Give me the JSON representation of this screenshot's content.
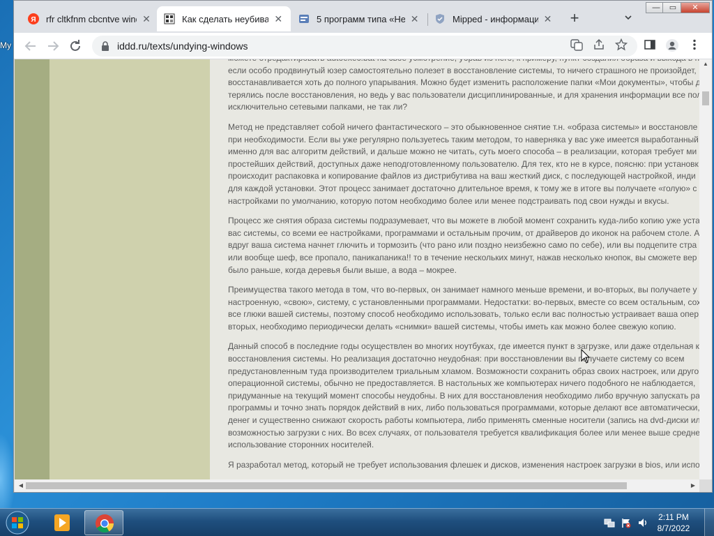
{
  "desktop": {
    "label": "Му"
  },
  "tabs": [
    {
      "label": "rfr cltkfnm cbcntve wind",
      "icon": "yandex-icon",
      "active": false
    },
    {
      "label": "Как сделать неубиваем",
      "icon": "site-favicon-icon",
      "active": true
    },
    {
      "label": "5 программ типа «Неу",
      "icon": "article-favicon-icon",
      "active": false
    },
    {
      "label": "Mipped - информацио",
      "icon": "shield-favicon-icon",
      "active": false
    }
  ],
  "toolbar": {
    "url": "iddd.ru/texts/undying-windows",
    "back_icon": "back-arrow-icon",
    "forward_icon": "forward-arrow-icon",
    "reload_icon": "reload-icon"
  },
  "article": {
    "paragraphs": [
      [
        "можете отредактировать autoexec.bat на свое усмотрение, убрав из него, к примеру, пункт создания образа и выхода в п",
        "если особо продвинутый юзер самостоятельно полезет в восстановление системы, то ничего страшного не произойдет,",
        "восстанавливается хоть до полного упарывания. Можно будет изменить расположение папки «Мои документы», чтобы д",
        "терялись после восстановления, но ведь у вас пользователи дисциплинированные, и для хранения информации все пол",
        "исключительно сетевыми папками, не так ли?"
      ],
      [
        "Метод не представляет собой ничего фантастического – это обыкновенное снятие т.н. «образа системы» и восстановле",
        "при необходимости. Если вы уже регулярно пользуетесь таким методом, то наверняка у вас уже имеется выработанный",
        "именно для вас алгоритм действий, и дальше можно не читать, суть моего способа – в реализации, которая требует ми",
        "простейших действий, доступных даже неподготовленному пользователю. Для тех, кто не в курсе, поясню: при установк",
        "происходит распаковка и копирование файлов из дистрибутива на ваш жесткий диск, с последующей настройкой, инди",
        "для каждой установки. Этот процесс занимает достаточно длительное время, к тому же в итоге вы получаете «голую» с",
        "настройками по умолчанию, которую потом необходимо более или менее подстраивать под свои нужды и вкусы."
      ],
      [
        "Процесс же снятия образа системы подразумевает, что вы можете в любой момент сохранить куда-либо копию уже уста",
        "вас системы, со всеми ее настройками, программами и остальным прочим, от драйверов до иконок на рабочем столе. А",
        "вдруг ваша система начнет глючить и тормозить (что рано или поздно неизбежно само по себе), или вы подцепите стра",
        "или вообще шеф, все пропало, паникапаника!! то в течение нескольких минут, нажав несколько кнопок, вы сможете вер",
        "было раньше, когда деревья были выше, а вода – мокрее."
      ],
      [
        "Преимущества такого метода в том, что во-первых, он занимает намного меньше времени, и во-вторых, вы получаете у",
        "настроенную, «свою», систему, с установленными программами. Недостатки: во-первых, вместе со всем остальным, сох",
        "все глюки вашей системы, поэтому способ необходимо использовать, только если вас полностью устраивает ваша опер",
        "вторых, необходимо периодически делать «снимки» вашей системы, чтобы иметь как можно более свежую копию."
      ],
      [
        "Данный способ в последние годы осуществлен во многих ноутбуках, где имеется пункт в загрузке, или даже отдельная к",
        "восстановления системы. Но реализация достаточно неудобная: при восстановлении вы получаете систему со всем",
        "предустановленным туда производителем триальным хламом. Возможности сохранить образ своих настроек, или друго",
        "операционной системы, обычно не предоставляется. В настольных же компьютерах ничего подобного не наблюдается,",
        "придуманные на текущий момент способы неудобны. В них для восстановления необходимо либо вручную запускать ра",
        "программы и точно знать порядок действий в них, либо пользоваться программами, которые делают все автоматически,",
        "денег и существенно снижают скорость работы компьютера, либо применять сменные носители (запись на dvd-диски ил",
        "возможностью загрузки с них. Во всех случаях, от пользователя требуется квалификация более или менее выше средне",
        "использование сторонних носителей."
      ],
      [
        "Я разработал метод, который не требует использования флешек и дисков, изменения настроек загрузки в bios, или испо"
      ]
    ]
  },
  "taskbar": {
    "apps": [
      "media-player-icon",
      "chrome-icon"
    ],
    "clock_time": "2:11 PM",
    "clock_date": "8/7/2022"
  }
}
